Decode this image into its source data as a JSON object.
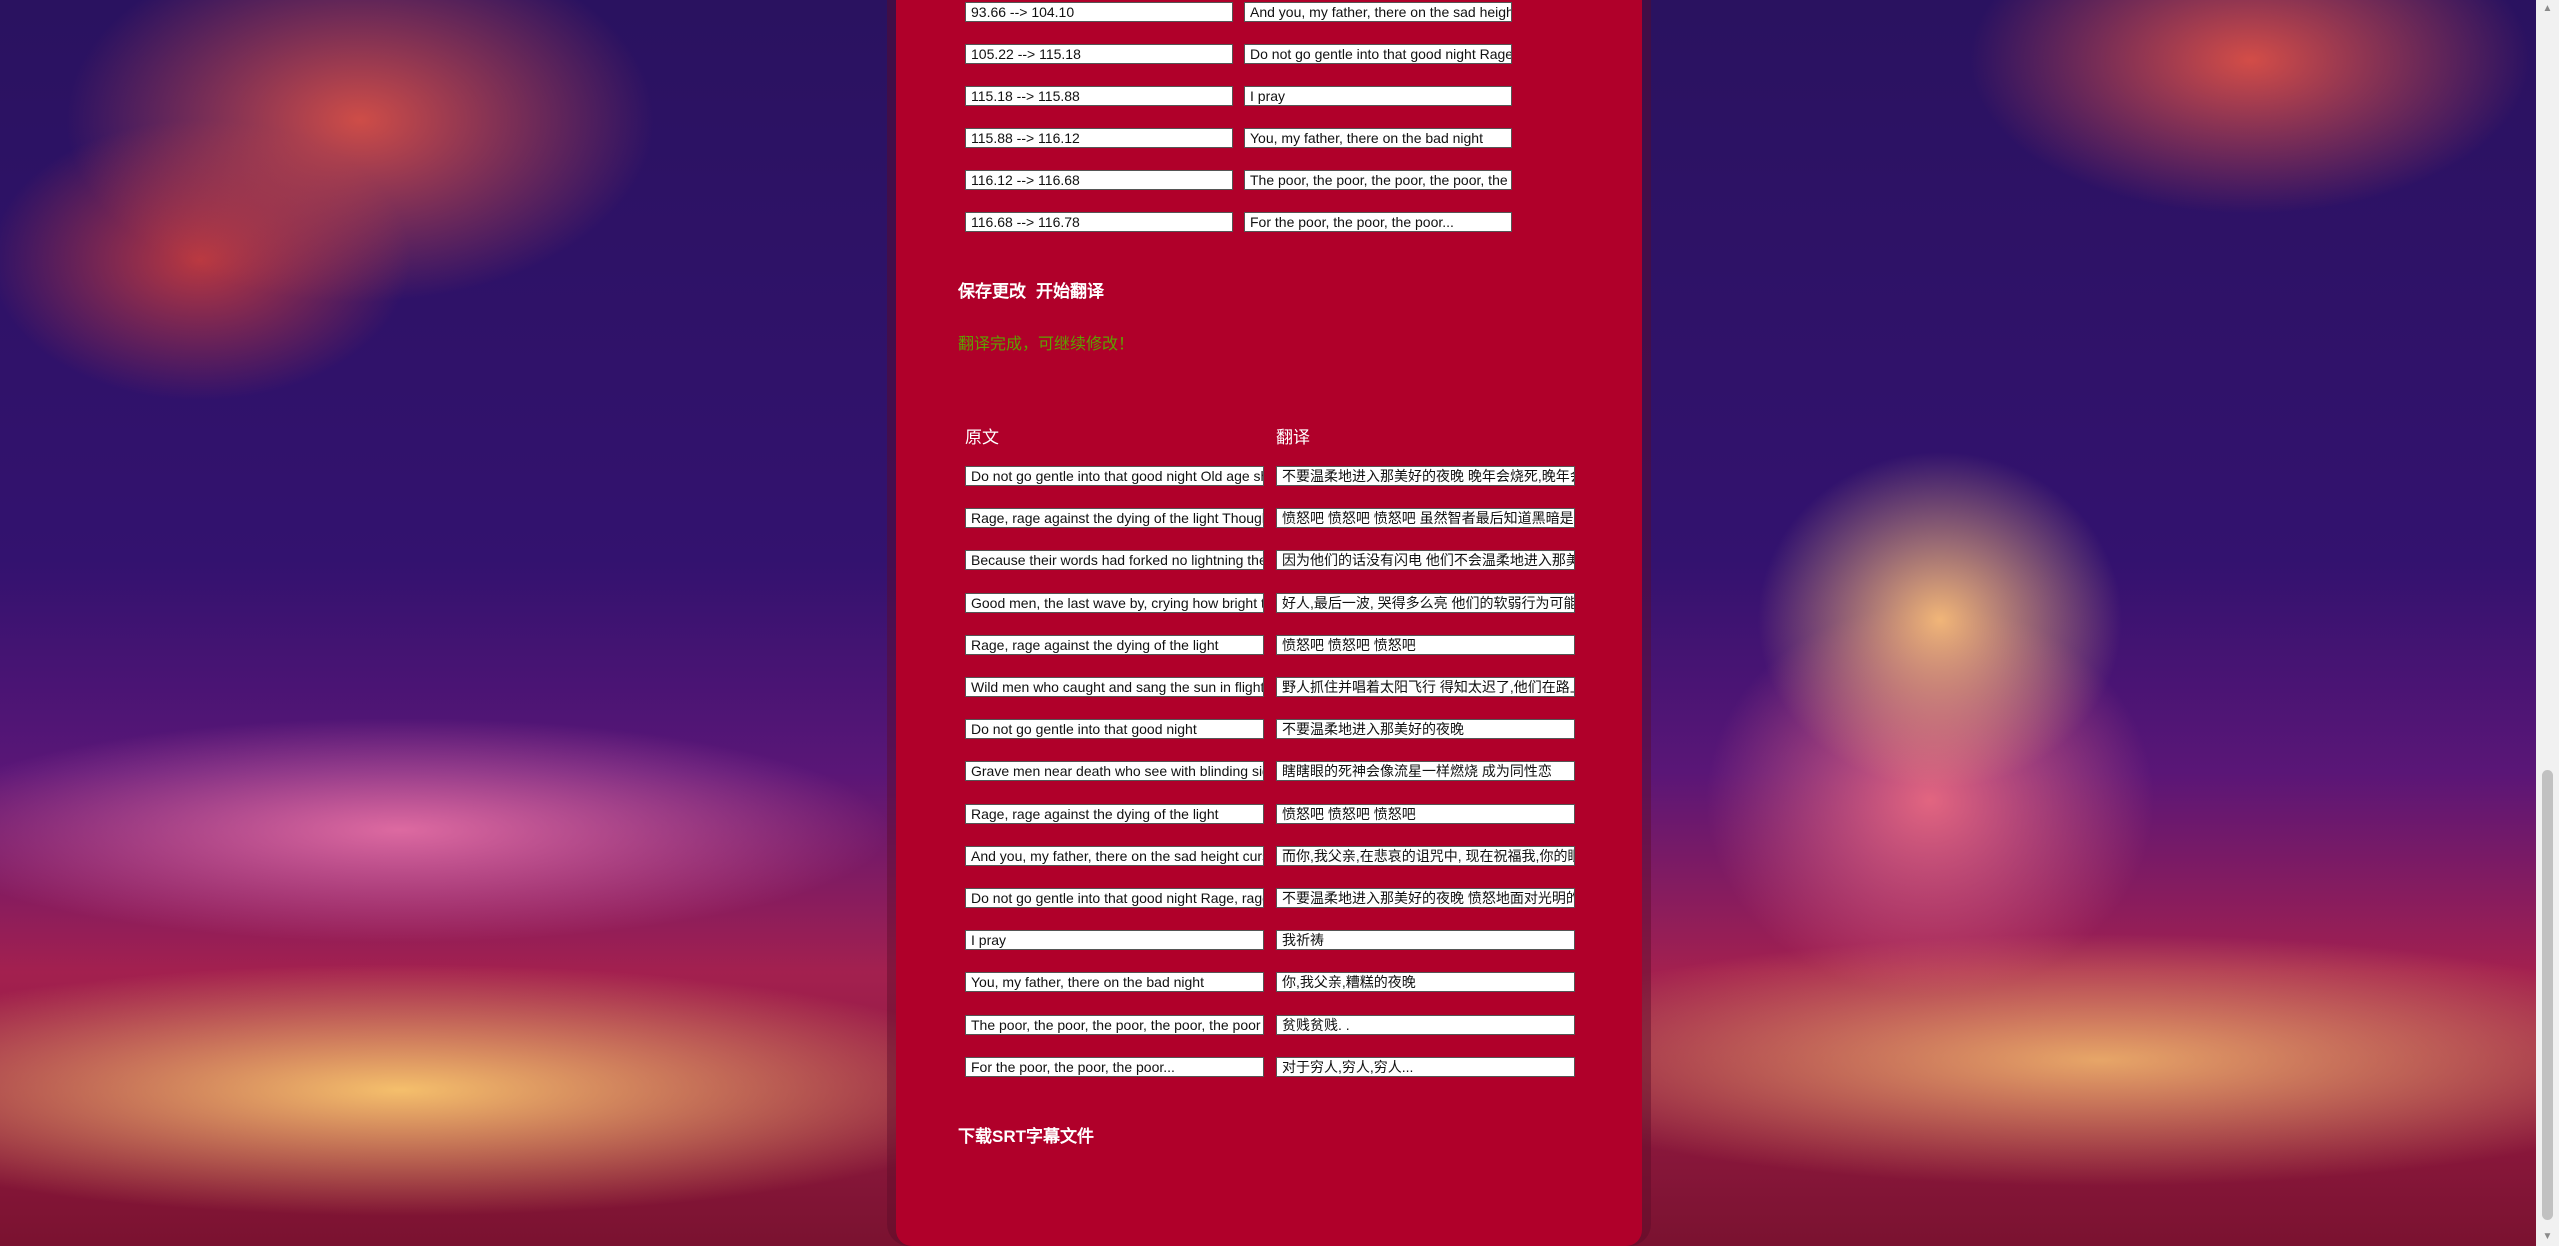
{
  "timing_rows": [
    {
      "time": "93.66 --> 104.10",
      "text": "And you, my father, there on the sad height"
    },
    {
      "time": "105.22 --> 115.18",
      "text": "Do not go gentle into that good night Rage, rage against the dying of the light"
    },
    {
      "time": "115.18 --> 115.88",
      "text": "I pray"
    },
    {
      "time": "115.88 --> 116.12",
      "text": "You, my father, there on the bad night"
    },
    {
      "time": "116.12 --> 116.68",
      "text": "The poor, the poor, the poor, the poor, the poor"
    },
    {
      "time": "116.68 --> 116.78",
      "text": "For the poor, the poor, the poor..."
    }
  ],
  "actions": {
    "save_label": "保存更改",
    "translate_label": "开始翻译",
    "download_label": "下载SRT字幕文件"
  },
  "status_text": "翻译完成，可继续修改！",
  "status_color": "#5ea000",
  "headers": {
    "original": "原文",
    "translation": "翻译"
  },
  "translation_rows": [
    {
      "original": "Do not go gentle into that good night Old age should burn and rave at close of day",
      "translation": "不要温柔地进入那美好的夜晚 晚年会烧死,晚年会疯狂"
    },
    {
      "original": "Rage, rage against the dying of the light Though wise men at their end know dark is right",
      "translation": "愤怒吧 愤怒吧 愤怒吧 虽然智者最后知道黑暗是对的"
    },
    {
      "original": "Because their words had forked no lightning they do not go gentle into that good night",
      "translation": "因为他们的话没有闪电 他们不会温柔地进入那美好的夜晚"
    },
    {
      "original": "Good men, the last wave by, crying how bright their frail deeds might have danced",
      "translation": "好人,最后一波, 哭得多么亮 他们的软弱行为可能会跳舞"
    },
    {
      "original": "Rage, rage against the dying of the light",
      "translation": "愤怒吧 愤怒吧 愤怒吧"
    },
    {
      "original": "Wild men who caught and sang the sun in flight and learn, too late, they grieved it on its way",
      "translation": "野人抓住并唱着太阳飞行 得知太迟了,他们在路上悲伤"
    },
    {
      "original": "Do not go gentle into that good night",
      "translation": "不要温柔地进入那美好的夜晚"
    },
    {
      "original": "Grave men near death who see with blinding sight blind eyes could blaze like meteors and be gay",
      "translation": "瞎瞎眼的死神会像流星一样燃烧 成为同性恋"
    },
    {
      "original": "Rage, rage against the dying of the light",
      "translation": "愤怒吧 愤怒吧 愤怒吧"
    },
    {
      "original": "And you, my father, there on the sad height curse, bless me now with your fierce tears",
      "translation": "而你,我父亲,在悲哀的诅咒中, 现在祝福我,你的眼泪"
    },
    {
      "original": "Do not go gentle into that good night Rage, rage against the dying of the light",
      "translation": "不要温柔地进入那美好的夜晚 愤怒地面对光明的消逝"
    },
    {
      "original": "I pray",
      "translation": "我祈祷"
    },
    {
      "original": "You, my father, there on the bad night",
      "translation": "你,我父亲,糟糕的夜晚"
    },
    {
      "original": "The poor, the poor, the poor, the poor, the poor",
      "translation": "贫贱贫贱. ."
    },
    {
      "original": "For the poor, the poor, the poor...",
      "translation": "对于穷人,穷人,穷人..."
    }
  ]
}
